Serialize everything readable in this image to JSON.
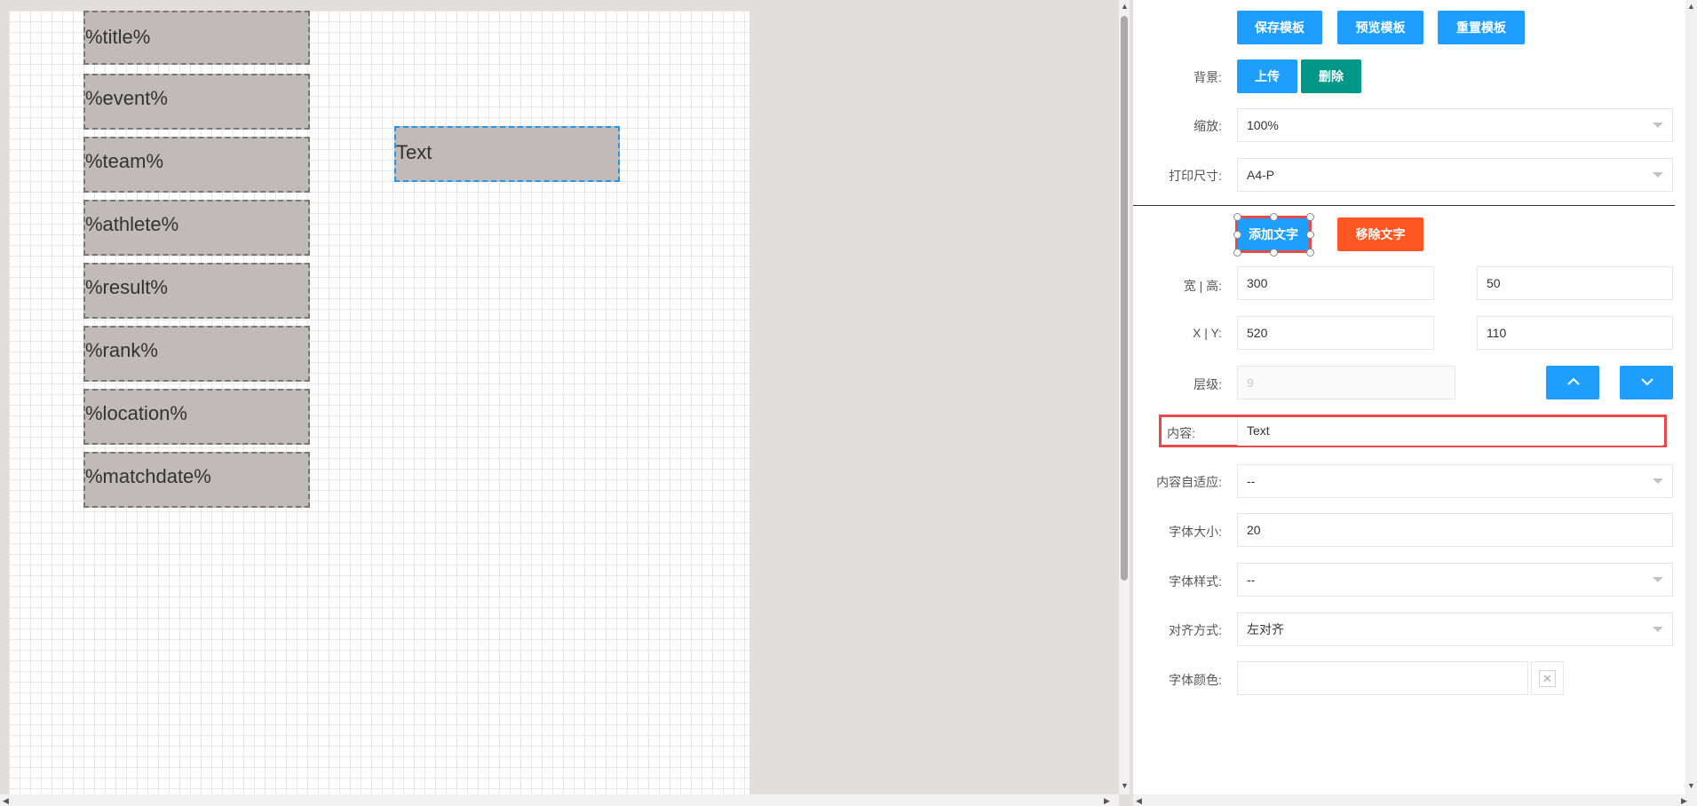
{
  "canvas_fields": [
    {
      "text": "%title%"
    },
    {
      "text": "%event%"
    },
    {
      "text": "%team%"
    },
    {
      "text": "%athlete%"
    },
    {
      "text": "%result%"
    },
    {
      "text": "%rank%"
    },
    {
      "text": "%location%"
    },
    {
      "text": "%matchdate%"
    }
  ],
  "selected_field": {
    "text": "Text"
  },
  "toolbar": {
    "save_label": "保存模板",
    "preview_label": "预览模板",
    "reset_label": "重置模板"
  },
  "background": {
    "label": "背景:",
    "upload_label": "上传",
    "delete_label": "删除"
  },
  "zoom": {
    "label": "缩放:",
    "value": "100%"
  },
  "print_size": {
    "label": "打印尺寸:",
    "value": "A4-P"
  },
  "text_actions": {
    "add_label": "添加文字",
    "remove_label": "移除文字"
  },
  "size": {
    "label": "宽 | 高:",
    "width": "300",
    "height": "50"
  },
  "position": {
    "label": "X | Y:",
    "x": "520",
    "y": "110"
  },
  "layer": {
    "label": "层级:",
    "value": "9"
  },
  "content": {
    "label": "内容:",
    "value": "Text"
  },
  "content_fit": {
    "label": "内容自适应:",
    "value": "--"
  },
  "font_size": {
    "label": "字体大小:",
    "value": "20"
  },
  "font_style": {
    "label": "字体样式:",
    "value": "--"
  },
  "alignment": {
    "label": "对齐方式:",
    "value": "左对齐"
  },
  "font_color": {
    "label": "字体颜色:",
    "value": ""
  },
  "colors": {
    "primary": "#1e9fff",
    "green": "#009688",
    "orange": "#ff5722",
    "highlight": "#e84a4a"
  }
}
